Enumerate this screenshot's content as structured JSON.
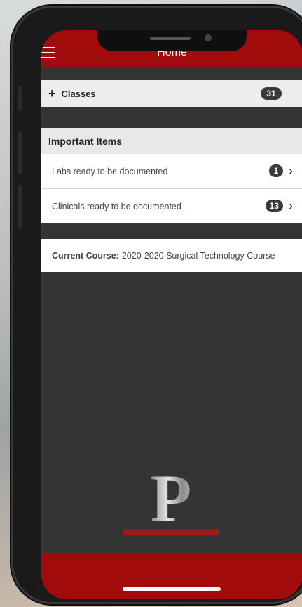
{
  "nav": {
    "title": "Home",
    "menu_icon": "hamburger-menu-icon"
  },
  "classes": {
    "label": "Classes",
    "count": "31",
    "icon": "plus-icon"
  },
  "important_items": {
    "header": "Important Items",
    "items": [
      {
        "label": "Labs ready to be documented",
        "count": "1"
      },
      {
        "label": "Clinicals ready to be documented",
        "count": "13"
      }
    ]
  },
  "current_course": {
    "key": "Current Course:",
    "value": "2020-2020 Surgical Technology Course"
  },
  "logo": {
    "letter": "P"
  },
  "colors": {
    "brand_red": "#a10b0b",
    "background": "#343434",
    "badge": "#3a3a3a"
  }
}
